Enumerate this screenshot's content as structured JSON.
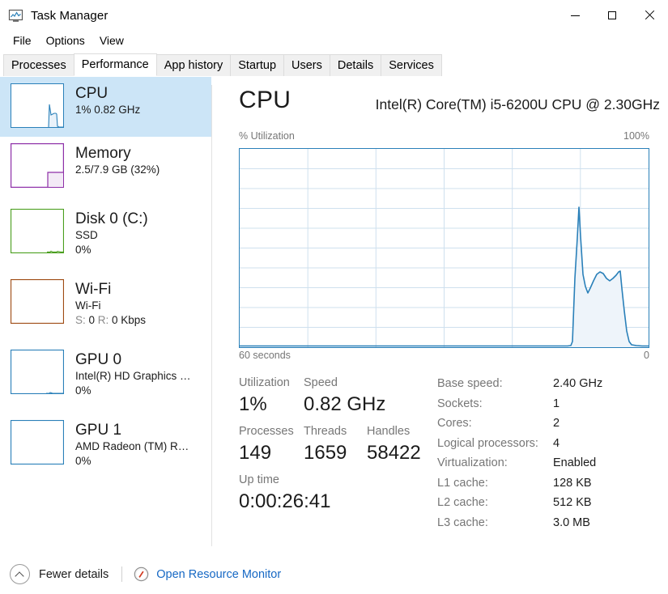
{
  "window": {
    "title": "Task Manager",
    "icon": "task-manager-icon",
    "controls": {
      "minimize": "–",
      "maximize": "□",
      "close": "✕"
    }
  },
  "menu": {
    "items": [
      "File",
      "Options",
      "View"
    ]
  },
  "tabs": {
    "items": [
      "Processes",
      "Performance",
      "App history",
      "Startup",
      "Users",
      "Details",
      "Services"
    ],
    "active": "Performance"
  },
  "sidebar": {
    "items": [
      {
        "name": "CPU",
        "title": "CPU",
        "sub1": "1%  0.82 GHz",
        "sub2": "",
        "sub3": "",
        "color": "#2a80b9",
        "selected": true
      },
      {
        "name": "Memory",
        "title": "Memory",
        "sub1": "2.5/7.9 GB (32%)",
        "sub2": "",
        "sub3": "",
        "color": "#8e2fa8",
        "selected": false
      },
      {
        "name": "Disk 0 (C:)",
        "title": "Disk 0 (C:)",
        "sub1": "SSD",
        "sub2": "0%",
        "sub3": "",
        "color": "#4a9e1e",
        "selected": false
      },
      {
        "name": "Wi-Fi",
        "title": "Wi-Fi",
        "sub1": "Wi-Fi",
        "sub2": "S: 0 R: 0 Kbps",
        "sub3": "",
        "color": "#9e4a12",
        "selected": false
      },
      {
        "name": "GPU 0",
        "title": "GPU 0",
        "sub1": "Intel(R) HD Graphics …",
        "sub2": "0%",
        "sub3": "",
        "color": "#2a80b9",
        "selected": false
      },
      {
        "name": "GPU 1",
        "title": "GPU 1",
        "sub1": "AMD Radeon (TM) R…",
        "sub2": "0%",
        "sub3": "",
        "color": "#2a80b9",
        "selected": false
      }
    ]
  },
  "main": {
    "title": "CPU",
    "model": "Intel(R) Core(TM) i5-6200U CPU @ 2.30GHz",
    "graph_label_left": "% Utilization",
    "graph_label_right": "100%",
    "time_label_left": "60 seconds",
    "time_label_right": "0",
    "stats": [
      {
        "label": "Utilization",
        "value": "1%"
      },
      {
        "label": "Speed",
        "value": "0.82 GHz"
      },
      {
        "label": "Processes",
        "value": "149"
      },
      {
        "label": "Threads",
        "value": "1659"
      },
      {
        "label": "Handles",
        "value": "58422"
      },
      {
        "label": "Up time",
        "value": "0:00:26:41"
      }
    ],
    "specs": [
      {
        "label": "Base speed:",
        "value": "2.40 GHz"
      },
      {
        "label": "Sockets:",
        "value": "1"
      },
      {
        "label": "Cores:",
        "value": "2"
      },
      {
        "label": "Logical processors:",
        "value": "4"
      },
      {
        "label": "Virtualization:",
        "value": "Enabled"
      },
      {
        "label": "L1 cache:",
        "value": "128 KB"
      },
      {
        "label": "L2 cache:",
        "value": "512 KB"
      },
      {
        "label": "L3 cache:",
        "value": "3.0 MB"
      }
    ]
  },
  "footer": {
    "fewer_details": "Fewer details",
    "open_resource_monitor": "Open Resource Monitor"
  },
  "colors": {
    "accent": "#2a80b9",
    "selection": "#cce5f7",
    "link": "#1668c4",
    "graph_fill": "#eef4fa",
    "grid": "#cfe0ee",
    "label_gray": "#767676"
  },
  "chart_data": {
    "type": "area",
    "title": "CPU % Utilization",
    "xlabel": "60 seconds",
    "ylabel": "% Utilization",
    "ylim": [
      0,
      100
    ],
    "xlim": [
      0,
      60
    ],
    "grid": true,
    "gridlines_x": 6,
    "gridlines_y": 10,
    "series": [
      {
        "name": "CPU Utilization",
        "x": [
          0,
          46,
          47,
          48,
          49,
          50,
          50.5,
          51,
          52,
          53,
          54,
          55,
          56,
          57,
          57.5,
          58,
          58.5,
          59,
          60
        ],
        "values": [
          0,
          0,
          3,
          30,
          62,
          47,
          30,
          25,
          22,
          26,
          31,
          29,
          27,
          30,
          31,
          22,
          8,
          2,
          1
        ]
      }
    ]
  }
}
